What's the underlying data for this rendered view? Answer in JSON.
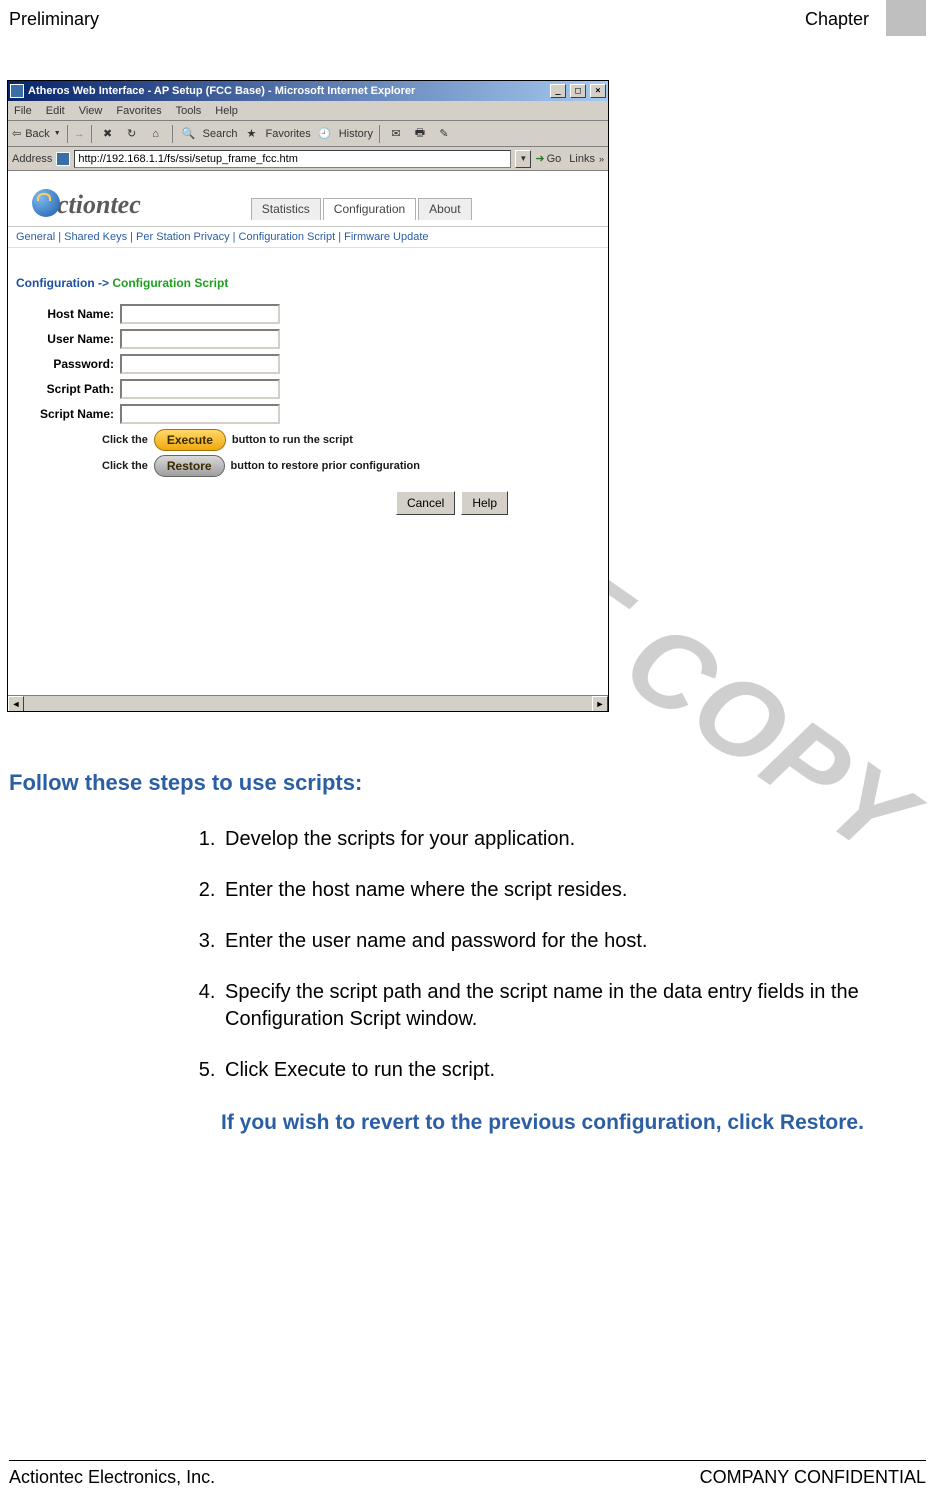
{
  "header": {
    "left": "Preliminary",
    "right": "Chapter"
  },
  "browser": {
    "title": "Atheros Web Interface - AP Setup (FCC Base) - Microsoft Internet Explorer",
    "menu": [
      "File",
      "Edit",
      "View",
      "Favorites",
      "Tools",
      "Help"
    ],
    "toolbar": {
      "back": "Back",
      "search": "Search",
      "favorites": "Favorites",
      "history": "History"
    },
    "address": {
      "label": "Address",
      "url": "http://192.168.1.1/fs/ssi/setup_frame_fcc.htm",
      "go": "Go",
      "links": "Links"
    },
    "logo_text": "ctiontec",
    "tabs": [
      "Statistics",
      "Configuration",
      "About"
    ],
    "sublinks": "General | Shared Keys | Per Station Privacy | Configuration Script | Firmware Update",
    "breadcrumb": {
      "first": "Configuration ->",
      "second": " Configuration Script"
    },
    "form": {
      "host_label": "Host Name:",
      "user_label": "User Name:",
      "password_label": "Password:",
      "scriptpath_label": "Script Path:",
      "scriptname_label": "Script Name:"
    },
    "hints": {
      "click_pre": "Click the",
      "execute_btn": "Execute",
      "execute_post": "button to run the script",
      "restore_btn": "Restore",
      "restore_post": "button to restore prior configuration"
    },
    "buttons": {
      "cancel": "Cancel",
      "help": "Help"
    }
  },
  "watermark": "DO NOT COPY",
  "section_heading": "Follow these steps to use scripts:",
  "steps": [
    "Develop the scripts for your application.",
    "Enter the host name where the script resides.",
    "Enter the user name and password for the host.",
    "Specify the script path and the script name in the data entry fields in the Configuration Script window.",
    "Click Execute to run the script."
  ],
  "revert_note": "If you wish to revert to the previous configuration, click Restore.",
  "footer": {
    "left": "Actiontec Electronics, Inc.",
    "right": "COMPANY CONFIDENTIAL"
  }
}
